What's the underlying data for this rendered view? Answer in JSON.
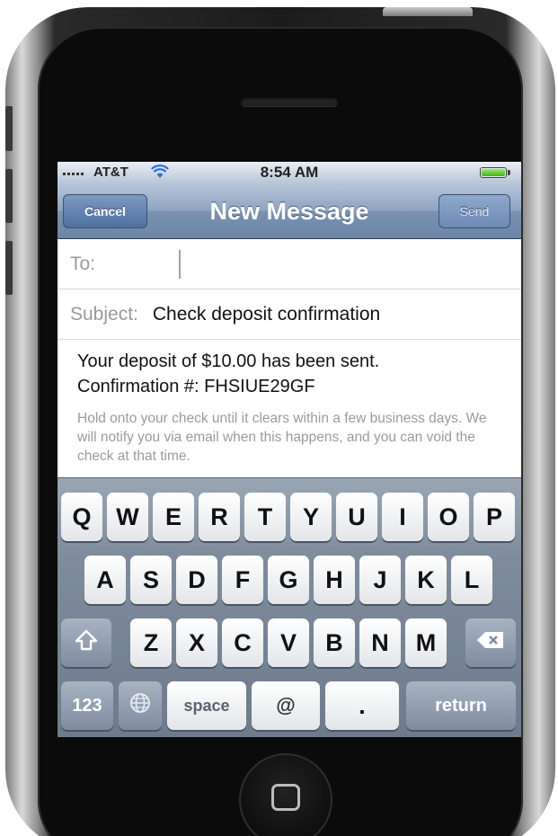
{
  "status_bar": {
    "carrier": "AT&T",
    "time": "8:54 AM",
    "wifi_icon": "wifi-icon",
    "battery_icon": "battery-icon"
  },
  "nav": {
    "cancel_label": "Cancel",
    "title": "New Message",
    "send_label": "Send"
  },
  "compose": {
    "to_label": "To:",
    "to_value": "",
    "subject_label": "Subject:",
    "subject_value": "Check deposit confirmation",
    "body_line1": "Your deposit of $10.00 has been sent.",
    "body_line2": "Confirmation #: FHSIUE29GF",
    "body_note": "Hold onto your check until it clears within a few business days. We will notify you via email when this happens, and you can void the check at that time."
  },
  "keyboard": {
    "row1": [
      "Q",
      "W",
      "E",
      "R",
      "T",
      "Y",
      "U",
      "I",
      "O",
      "P"
    ],
    "row2": [
      "A",
      "S",
      "D",
      "F",
      "G",
      "H",
      "J",
      "K",
      "L"
    ],
    "row3": [
      "Z",
      "X",
      "C",
      "V",
      "B",
      "N",
      "M"
    ],
    "numbers_label": "123",
    "globe_icon": "globe-icon",
    "space_label": "space",
    "at_label": "@",
    "dot_label": ".",
    "return_label": "return",
    "shift_icon": "shift-icon",
    "backspace_icon": "backspace-icon"
  },
  "colors": {
    "nav_blue": "#6d86a8",
    "keyboard_bg": "#7f8c9c",
    "battery_green": "#3fb31b"
  }
}
